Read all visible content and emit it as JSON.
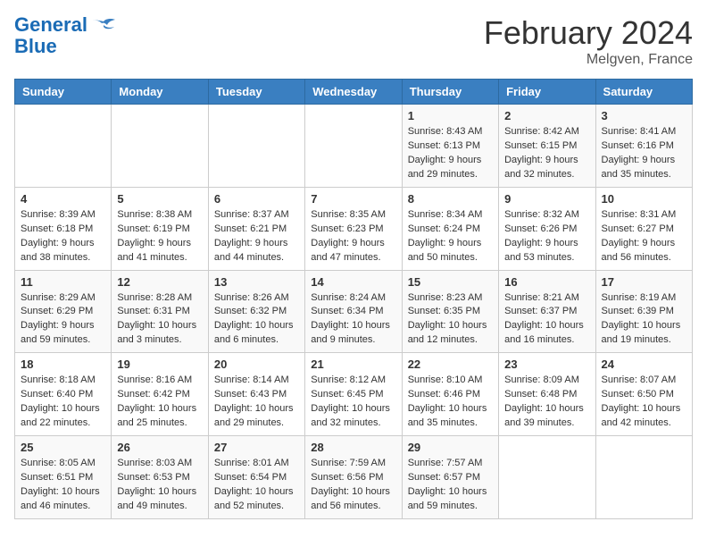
{
  "header": {
    "logo_line1": "General",
    "logo_line2": "Blue",
    "title": "February 2024",
    "subtitle": "Melgven, France"
  },
  "days_of_week": [
    "Sunday",
    "Monday",
    "Tuesday",
    "Wednesday",
    "Thursday",
    "Friday",
    "Saturday"
  ],
  "weeks": [
    [
      {
        "day": "",
        "info": ""
      },
      {
        "day": "",
        "info": ""
      },
      {
        "day": "",
        "info": ""
      },
      {
        "day": "",
        "info": ""
      },
      {
        "day": "1",
        "info": "Sunrise: 8:43 AM\nSunset: 6:13 PM\nDaylight: 9 hours and 29 minutes."
      },
      {
        "day": "2",
        "info": "Sunrise: 8:42 AM\nSunset: 6:15 PM\nDaylight: 9 hours and 32 minutes."
      },
      {
        "day": "3",
        "info": "Sunrise: 8:41 AM\nSunset: 6:16 PM\nDaylight: 9 hours and 35 minutes."
      }
    ],
    [
      {
        "day": "4",
        "info": "Sunrise: 8:39 AM\nSunset: 6:18 PM\nDaylight: 9 hours and 38 minutes."
      },
      {
        "day": "5",
        "info": "Sunrise: 8:38 AM\nSunset: 6:19 PM\nDaylight: 9 hours and 41 minutes."
      },
      {
        "day": "6",
        "info": "Sunrise: 8:37 AM\nSunset: 6:21 PM\nDaylight: 9 hours and 44 minutes."
      },
      {
        "day": "7",
        "info": "Sunrise: 8:35 AM\nSunset: 6:23 PM\nDaylight: 9 hours and 47 minutes."
      },
      {
        "day": "8",
        "info": "Sunrise: 8:34 AM\nSunset: 6:24 PM\nDaylight: 9 hours and 50 minutes."
      },
      {
        "day": "9",
        "info": "Sunrise: 8:32 AM\nSunset: 6:26 PM\nDaylight: 9 hours and 53 minutes."
      },
      {
        "day": "10",
        "info": "Sunrise: 8:31 AM\nSunset: 6:27 PM\nDaylight: 9 hours and 56 minutes."
      }
    ],
    [
      {
        "day": "11",
        "info": "Sunrise: 8:29 AM\nSunset: 6:29 PM\nDaylight: 9 hours and 59 minutes."
      },
      {
        "day": "12",
        "info": "Sunrise: 8:28 AM\nSunset: 6:31 PM\nDaylight: 10 hours and 3 minutes."
      },
      {
        "day": "13",
        "info": "Sunrise: 8:26 AM\nSunset: 6:32 PM\nDaylight: 10 hours and 6 minutes."
      },
      {
        "day": "14",
        "info": "Sunrise: 8:24 AM\nSunset: 6:34 PM\nDaylight: 10 hours and 9 minutes."
      },
      {
        "day": "15",
        "info": "Sunrise: 8:23 AM\nSunset: 6:35 PM\nDaylight: 10 hours and 12 minutes."
      },
      {
        "day": "16",
        "info": "Sunrise: 8:21 AM\nSunset: 6:37 PM\nDaylight: 10 hours and 16 minutes."
      },
      {
        "day": "17",
        "info": "Sunrise: 8:19 AM\nSunset: 6:39 PM\nDaylight: 10 hours and 19 minutes."
      }
    ],
    [
      {
        "day": "18",
        "info": "Sunrise: 8:18 AM\nSunset: 6:40 PM\nDaylight: 10 hours and 22 minutes."
      },
      {
        "day": "19",
        "info": "Sunrise: 8:16 AM\nSunset: 6:42 PM\nDaylight: 10 hours and 25 minutes."
      },
      {
        "day": "20",
        "info": "Sunrise: 8:14 AM\nSunset: 6:43 PM\nDaylight: 10 hours and 29 minutes."
      },
      {
        "day": "21",
        "info": "Sunrise: 8:12 AM\nSunset: 6:45 PM\nDaylight: 10 hours and 32 minutes."
      },
      {
        "day": "22",
        "info": "Sunrise: 8:10 AM\nSunset: 6:46 PM\nDaylight: 10 hours and 35 minutes."
      },
      {
        "day": "23",
        "info": "Sunrise: 8:09 AM\nSunset: 6:48 PM\nDaylight: 10 hours and 39 minutes."
      },
      {
        "day": "24",
        "info": "Sunrise: 8:07 AM\nSunset: 6:50 PM\nDaylight: 10 hours and 42 minutes."
      }
    ],
    [
      {
        "day": "25",
        "info": "Sunrise: 8:05 AM\nSunset: 6:51 PM\nDaylight: 10 hours and 46 minutes."
      },
      {
        "day": "26",
        "info": "Sunrise: 8:03 AM\nSunset: 6:53 PM\nDaylight: 10 hours and 49 minutes."
      },
      {
        "day": "27",
        "info": "Sunrise: 8:01 AM\nSunset: 6:54 PM\nDaylight: 10 hours and 52 minutes."
      },
      {
        "day": "28",
        "info": "Sunrise: 7:59 AM\nSunset: 6:56 PM\nDaylight: 10 hours and 56 minutes."
      },
      {
        "day": "29",
        "info": "Sunrise: 7:57 AM\nSunset: 6:57 PM\nDaylight: 10 hours and 59 minutes."
      },
      {
        "day": "",
        "info": ""
      },
      {
        "day": "",
        "info": ""
      }
    ]
  ]
}
